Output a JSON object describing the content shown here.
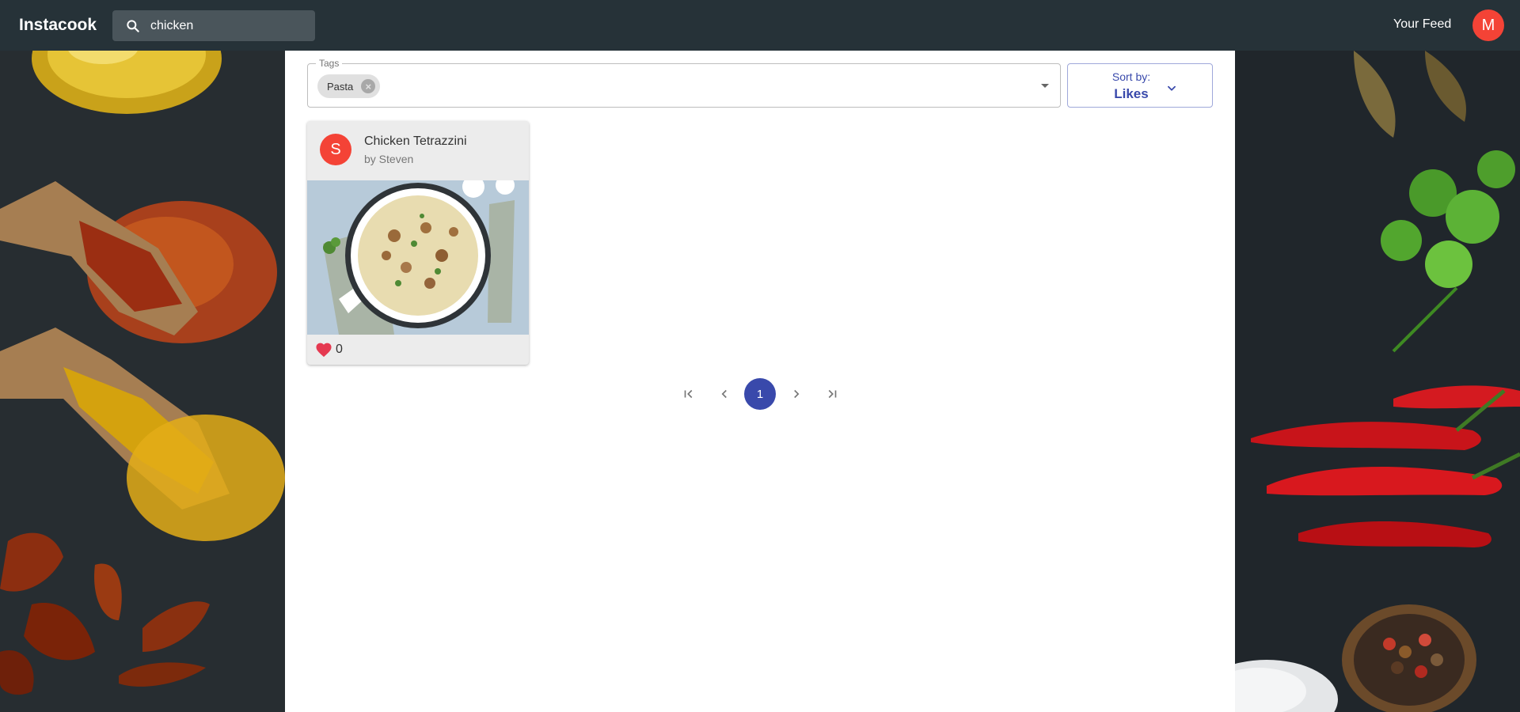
{
  "app": {
    "title": "Instacook"
  },
  "search": {
    "value": "chicken",
    "icon": "search-icon"
  },
  "header": {
    "feed_link": "Your Feed",
    "user_initial": "M",
    "avatar_color": "#f44336"
  },
  "filters": {
    "tags_label": "Tags",
    "selected_tags": [
      {
        "label": "Pasta"
      }
    ],
    "sort_caption": "Sort by:",
    "sort_value": "Likes"
  },
  "recipes": [
    {
      "title": "Chicken Tetrazzini",
      "author": "by Steven",
      "author_initial": "S",
      "avatar_color": "#f44336",
      "likes": "0"
    }
  ],
  "pagination": {
    "current_page": "1"
  },
  "colors": {
    "topbar": "#263238",
    "accent": "#3949ab",
    "heart": "#e53950"
  }
}
